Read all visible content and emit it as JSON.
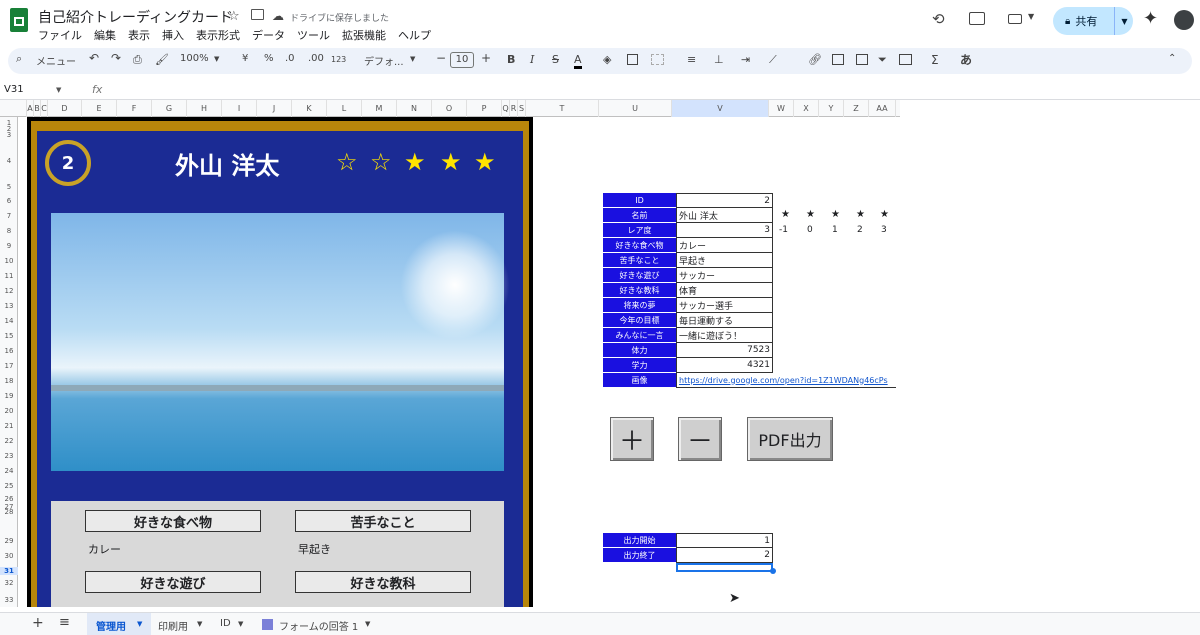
{
  "app": {
    "title": "自己紹介トレーディングカード",
    "save_status": "ドライブに保存しました",
    "share_label": "共有"
  },
  "menu": [
    "ファイル",
    "編集",
    "表示",
    "挿入",
    "表示形式",
    "データ",
    "ツール",
    "拡張機能",
    "ヘルプ"
  ],
  "toolbar": {
    "search_label": "メニュー",
    "zoom": "100%",
    "currency": "¥",
    "percent": "%",
    "dec_less": ".0",
    "dec_more": ".00",
    "format_num": "123",
    "font": "デフォ...",
    "font_size": "10",
    "bold": "B",
    "italic": "I",
    "strike": "S",
    "text_color": "A",
    "sum": "Σ",
    "input_mode": "あ"
  },
  "formula_bar": {
    "cell_ref": "V31",
    "fx": "fx"
  },
  "columns": [
    "A",
    "B",
    "C",
    "D",
    "E",
    "F",
    "G",
    "H",
    "I",
    "J",
    "K",
    "L",
    "M",
    "N",
    "O",
    "P",
    "Q",
    "R",
    "S",
    "T",
    "U",
    "V",
    "W",
    "X",
    "Y",
    "Z",
    "AA"
  ],
  "rows": [
    "1",
    "2",
    "3",
    "4",
    "5",
    "6",
    "7",
    "8",
    "9",
    "10",
    "11",
    "12",
    "13",
    "14",
    "15",
    "16",
    "17",
    "18",
    "19",
    "20",
    "21",
    "22",
    "23",
    "24",
    "25",
    "26",
    "27",
    "28",
    "29",
    "30",
    "31",
    "32",
    "33"
  ],
  "card": {
    "number": "2",
    "name": "外山 洋太",
    "stars": [
      "☆",
      "☆",
      "★",
      "★",
      "★"
    ],
    "labels": {
      "food": "好きな食べ物",
      "dislike": "苦手なこと",
      "play": "好きな遊び",
      "subject": "好きな教科"
    },
    "values": {
      "food": "カレー",
      "dislike": "早起き"
    }
  },
  "table": [
    {
      "label": "ID",
      "value": "2",
      "align": "right"
    },
    {
      "label": "名前",
      "value": "外山 洋太",
      "align": "left"
    },
    {
      "label": "レア度",
      "value": "3",
      "align": "right"
    },
    {
      "label": "好きな食べ物",
      "value": "カレー",
      "align": "left"
    },
    {
      "label": "苦手なこと",
      "value": "早起き",
      "align": "left"
    },
    {
      "label": "好きな遊び",
      "value": "サッカー",
      "align": "left"
    },
    {
      "label": "好きな教科",
      "value": "体育",
      "align": "left"
    },
    {
      "label": "将来の夢",
      "value": "サッカー選手",
      "align": "left"
    },
    {
      "label": "今年の目標",
      "value": "毎日運動する",
      "align": "left"
    },
    {
      "label": "みんなに一言",
      "value": "一緒に遊ぼう！",
      "align": "left"
    },
    {
      "label": "体力",
      "value": "7523",
      "align": "right"
    },
    {
      "label": "学力",
      "value": "4321",
      "align": "right"
    },
    {
      "label": "画像",
      "value": "https://drive.google.com/open?id=1Z1WDANg46cPs",
      "align": "left"
    }
  ],
  "rarity_stars": [
    "★",
    "★",
    "★",
    "★",
    "★"
  ],
  "rarity_nums": [
    "-1",
    "0",
    "1",
    "2",
    "3"
  ],
  "buttons": {
    "plus": "＋",
    "minus": "－",
    "pdf": "PDF出力"
  },
  "output": [
    {
      "label": "出力開始",
      "value": "1"
    },
    {
      "label": "出力終了",
      "value": "2"
    }
  ],
  "tabs": {
    "add": "+",
    "list": "≡",
    "active": "管理用",
    "print": "印刷用",
    "id": "ID",
    "form": "フォームの回答 1"
  }
}
